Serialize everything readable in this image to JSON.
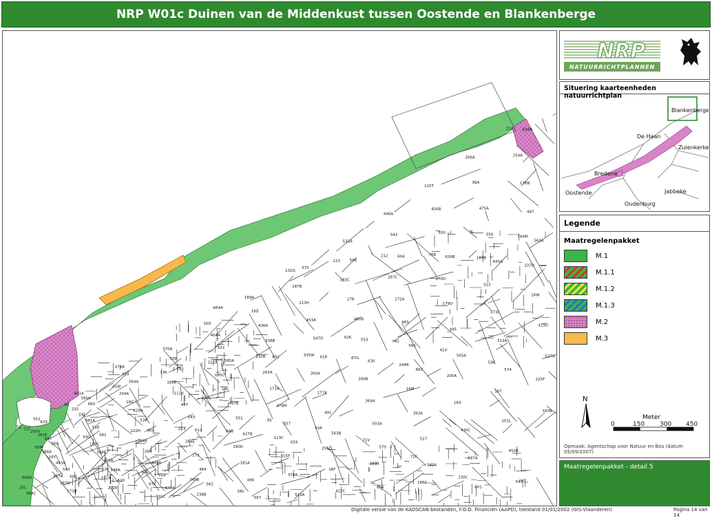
{
  "title": "NRP W01c Duinen van de Middenkust tussen Oostende en Blankenberge",
  "logo": {
    "letters": "NRP",
    "tagline": "NATUURRICHTPLANNEN"
  },
  "location_map": {
    "title": "Situering kaarteenheden natuurrichtplan",
    "places": [
      "Blankenberge",
      "De Haan",
      "Zuienkerke",
      "Bredene",
      "Oostende",
      "Jabbeke",
      "Oudenburg"
    ]
  },
  "legend": {
    "title": "Legende",
    "subtitle": "Maatregelenpakket",
    "items": [
      {
        "label": "M.1",
        "color": "#3bb54a",
        "pattern": "solid"
      },
      {
        "label": "M.1.1",
        "color": "#3bb54a",
        "stripe": "#e03020",
        "pattern": "stripes"
      },
      {
        "label": "M.1.2",
        "color": "#3bb54a",
        "stripe": "#f2ea2a",
        "pattern": "stripes"
      },
      {
        "label": "M.1.3",
        "color": "#3bb54a",
        "stripe": "#2a6fc9",
        "pattern": "stripes"
      },
      {
        "label": "M.2",
        "color": "#d983c8",
        "pattern": "dots"
      },
      {
        "label": "M.3",
        "color": "#f6b94a",
        "pattern": "solid"
      }
    ]
  },
  "scale": {
    "north": "N",
    "unit": "Meter",
    "ticks": [
      "0",
      "150",
      "300",
      "450"
    ]
  },
  "credit": "Opmaak: Agentschap voor Natuur en Bos (datum 05/09/2007)",
  "detail_label": "Maatregelenpakket - detail 5",
  "footer": {
    "source": "Digitale versie van de KADSCAN-bestanden, F.O.D. Financiën (AAPD), toestand 01/01/2002 (GIS-Vlaanderen)",
    "page": "Pagina 14 van 14"
  },
  "parcels": [
    "52",
    "62K",
    "62L",
    "9L",
    "9S",
    "9V",
    "741",
    "745B",
    "744M",
    "41R",
    "41W",
    "41V",
    "58C",
    "65M",
    "71V",
    "73K",
    "33K",
    "132G",
    "33G",
    "72K",
    "222A",
    "225F",
    "223",
    "222H",
    "230C",
    "232B",
    "217A",
    "212",
    "213",
    "214",
    "335W",
    "192A",
    "76B",
    "84B",
    "71T",
    "87G",
    "87K",
    "109B",
    "113C",
    "335",
    "244B",
    "238B",
    "237D",
    "256C",
    "204A",
    "205A",
    "189A",
    "188A",
    "189B",
    "188B",
    "187",
    "187B",
    "187C",
    "186C",
    "185C",
    "183B",
    "183C",
    "264B",
    "266A",
    "263A",
    "267D",
    "267C",
    "264E",
    "254A",
    "260A",
    "272E",
    "270D",
    "290D",
    "297V",
    "300B",
    "301C",
    "313",
    "315F",
    "331",
    "16M",
    "16D",
    "16W",
    "16F",
    "16G",
    "16X",
    "16Z",
    "16Y",
    "91A",
    "111V",
    "101L",
    "113H",
    "114C",
    "115T",
    "18C",
    "25C",
    "27B",
    "29A",
    "36A",
    "171A",
    "171B",
    "172A",
    "173",
    "176B",
    "177A",
    "178A",
    "179D",
    "181A",
    "181E",
    "369A",
    "370A",
    "373C",
    "378A",
    "381A",
    "393A",
    "404A",
    "415D",
    "422C",
    "429A",
    "430C",
    "436A",
    "443A",
    "446A",
    "447",
    "452B",
    "453A",
    "455B",
    "456B",
    "457B",
    "458C",
    "460B",
    "471B",
    "475A",
    "478M",
    "481A",
    "483",
    "484",
    "487",
    "491",
    "493",
    "495",
    "496",
    "497",
    "503A",
    "509",
    "512A",
    "513A",
    "516",
    "517",
    "522",
    "527A",
    "533A",
    "536",
    "537A",
    "538B",
    "540",
    "542",
    "543",
    "544",
    "547D",
    "548A",
    "550",
    "551",
    "552",
    "553",
    "554",
    "556",
    "557",
    "560A",
    "561",
    "562",
    "563A",
    "563B",
    "564A",
    "565A",
    "567",
    "568",
    "570",
    "571",
    "574",
    "575",
    "581",
    "583A",
    "585A",
    "593D",
    "598",
    "600",
    "601",
    "602",
    "603",
    "604",
    "613",
    "616B",
    "618",
    "620",
    "626B",
    "627B",
    "629",
    "630",
    "640A",
    "650A",
    "659",
    "660",
    "663",
    "664A"
  ]
}
